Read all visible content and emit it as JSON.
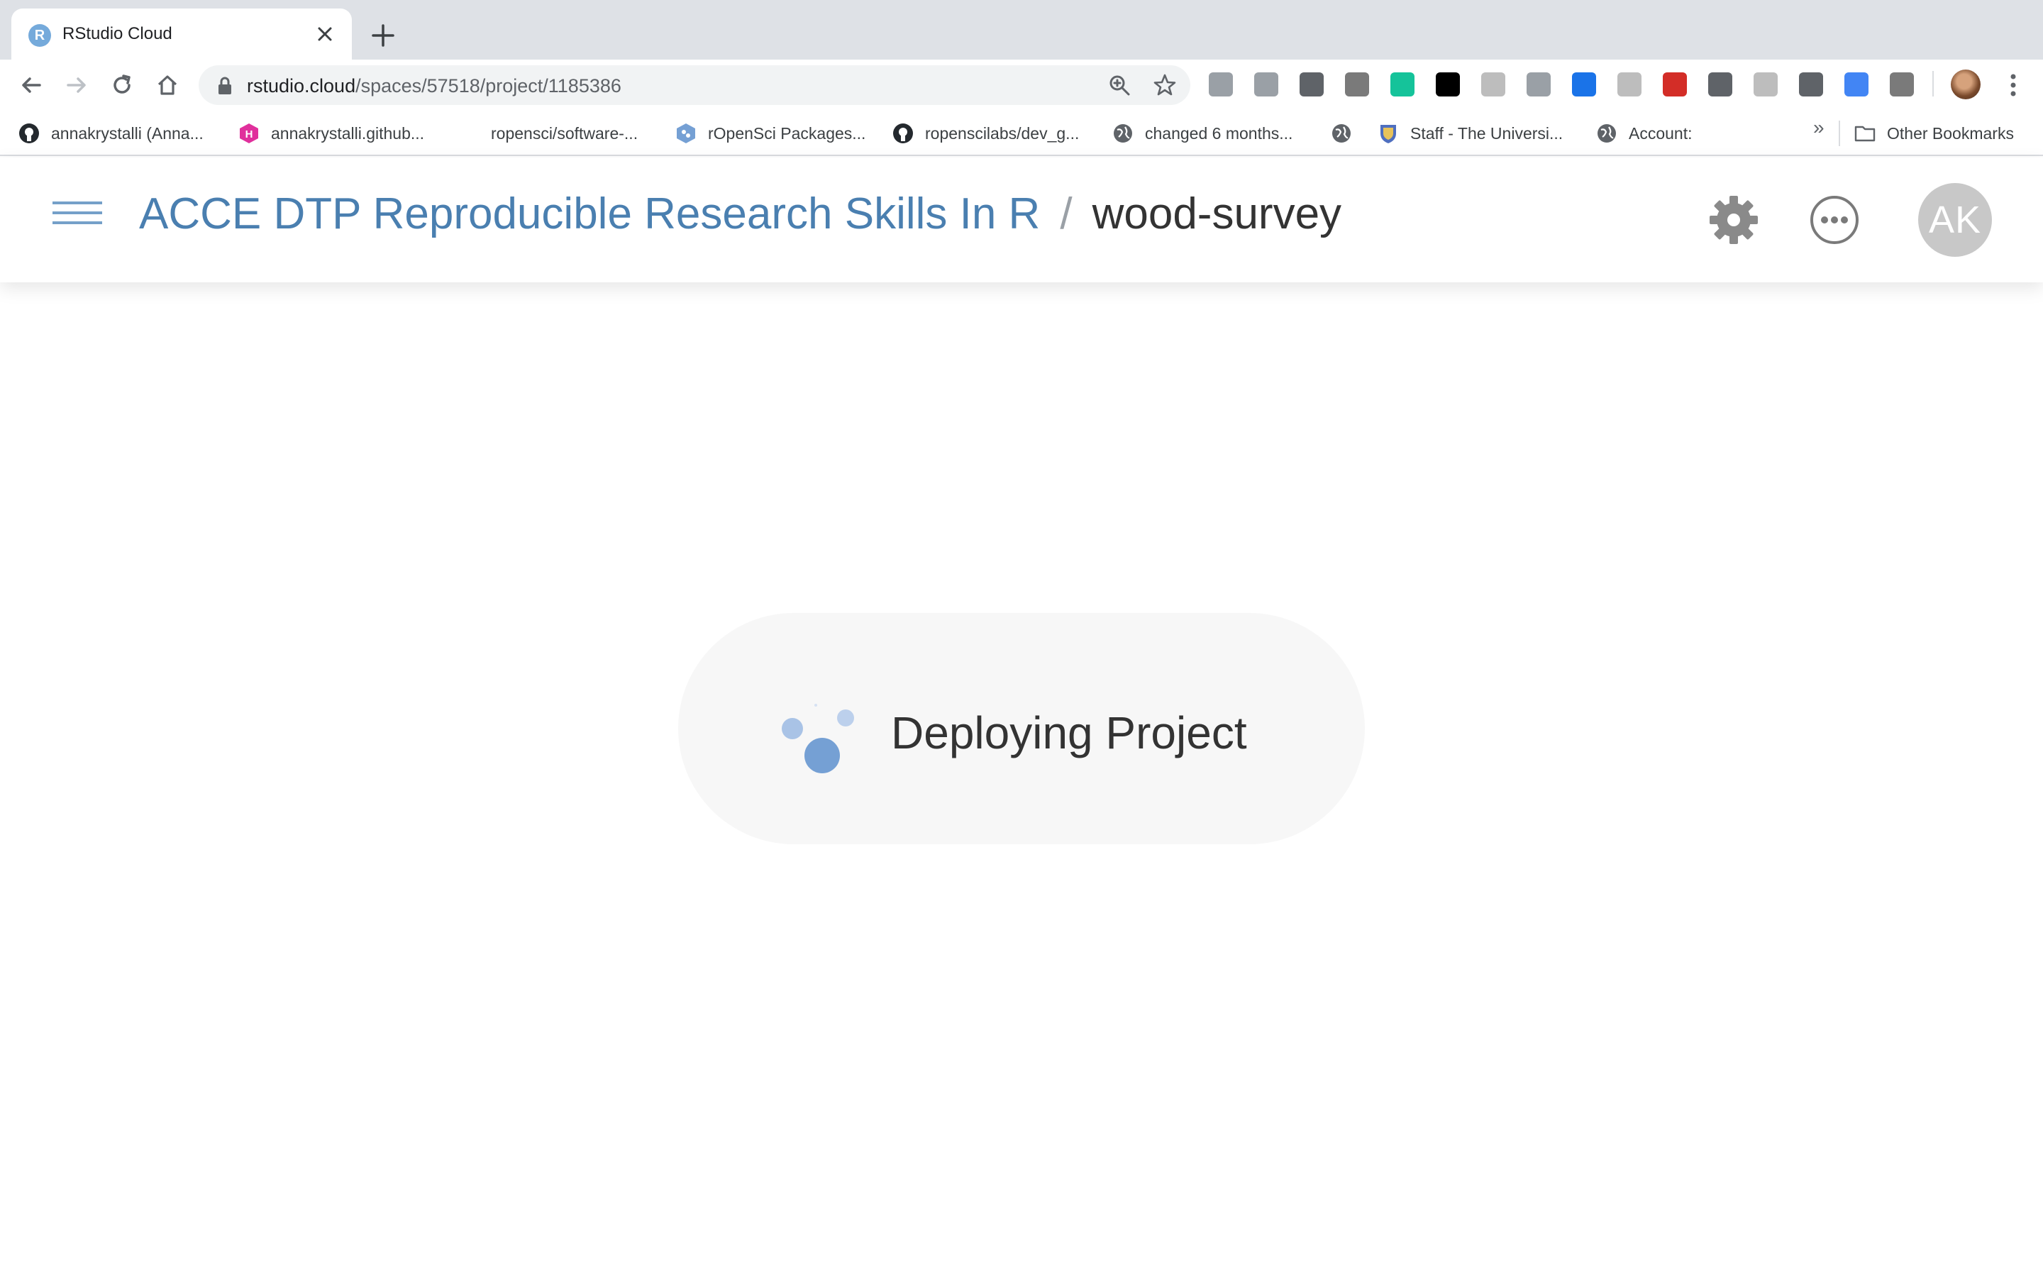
{
  "browser": {
    "tab": {
      "title": "RStudio Cloud",
      "favicon_letter": "R",
      "favicon_icon": "rstudio-icon"
    },
    "address": {
      "host": "rstudio.cloud",
      "path": "/spaces/57518/project/1185386"
    },
    "extensions": [
      {
        "name": "ghostery-icon",
        "color": "#9aa0a6"
      },
      {
        "name": "dropbox-icon",
        "color": "#9aa0a6"
      },
      {
        "name": "hypothesis-icon",
        "color": "#5f6368"
      },
      {
        "name": "zotero-icon",
        "color": "#7a7a7a"
      },
      {
        "name": "grammarly-icon",
        "color": "#15c39a"
      },
      {
        "name": "lock-extension-icon",
        "color": "#000000"
      },
      {
        "name": "bi-extension-icon",
        "color": "#bdbdbd"
      },
      {
        "name": "exclaim-extension-icon",
        "color": "#9aa0a6"
      },
      {
        "name": "library-icon",
        "color": "#1a73e8"
      },
      {
        "name": "google-icon",
        "color": "#bdbdbd"
      },
      {
        "name": "lastpass-icon",
        "color": "#d32d27"
      },
      {
        "name": "eyedropper-icon",
        "color": "#5f6368"
      },
      {
        "name": "rmd-extension-icon",
        "color": "#bdbdbd"
      },
      {
        "name": "medium-icon",
        "color": "#5f6368"
      },
      {
        "name": "google-translate-icon",
        "color": "#4285f4"
      },
      {
        "name": "circle-extension-icon",
        "color": "#7a7a7a"
      }
    ],
    "bookmarks": [
      {
        "label": "annakrystalli (Anna...",
        "icon": "github-icon"
      },
      {
        "label": "annakrystalli.github...",
        "icon": "hexo-icon"
      },
      {
        "label": "ropensci/software-...",
        "icon": ""
      },
      {
        "label": "rOpenSci Packages...",
        "icon": "ropensci-icon"
      },
      {
        "label": "ropenscilabs/dev_g...",
        "icon": "github-icon"
      },
      {
        "label": "changed 6 months...",
        "icon": "globe-icon"
      },
      {
        "label": "",
        "icon": "globe-icon"
      },
      {
        "label": "Staff - The Universi...",
        "icon": "university-shield-icon"
      },
      {
        "label": "Account:",
        "icon": "globe-icon"
      }
    ],
    "bookmarks_overflow": "»",
    "other_bookmarks": "Other Bookmarks"
  },
  "header": {
    "space_name": "ACCE DTP Reproducible Research Skills In R",
    "separator": "/",
    "project_name": "wood-survey",
    "avatar_initials": "AK"
  },
  "status": {
    "message": "Deploying Project"
  },
  "colors": {
    "link_blue": "#4a7fb0",
    "spinner_blue": "#75a0d4",
    "pill_bg": "#f7f7f7"
  }
}
